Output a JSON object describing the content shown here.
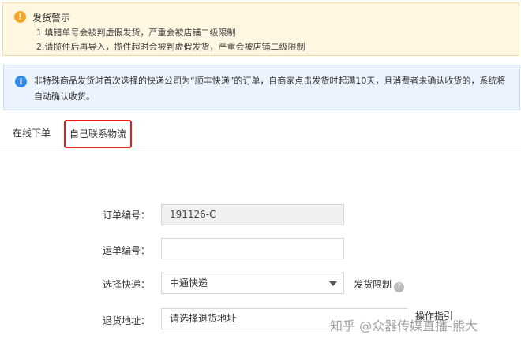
{
  "warning": {
    "icon": "warning-icon",
    "title": "发货警示",
    "lines": [
      "1.填错单号会被判虚假发货，严重会被店铺二级限制",
      "2.请揽件后再导入，揽件超时会被判虚假发货，严重会被店铺二级限制"
    ]
  },
  "info": {
    "icon": "info-icon",
    "text": "非特殊商品发货时首次选择的快递公司为“顺丰快递”的订单，自商家点击发货时起满10天，且消费者未确认收货的，系统将自动确认收货。"
  },
  "tabs": [
    {
      "label": "在线下单",
      "active": false
    },
    {
      "label": "自己联系物流",
      "active": true
    }
  ],
  "form": {
    "order_no_label": "订单编号：",
    "order_no_value": "191126-C",
    "tracking_no_label": "运单编号：",
    "tracking_no_value": "",
    "courier_label": "选择快递：",
    "courier_value": "中通快递",
    "shipping_limit_label": "发货限制",
    "return_address_label": "退货地址：",
    "return_address_value": "请选择退货地址",
    "partial_label": "操作指引"
  },
  "watermark": "知乎 @众器传媒直播-熊大",
  "colors": {
    "highlight_border": "#e02020",
    "warning_bg": "#fff7e1",
    "info_bg": "#eaf3fe"
  }
}
